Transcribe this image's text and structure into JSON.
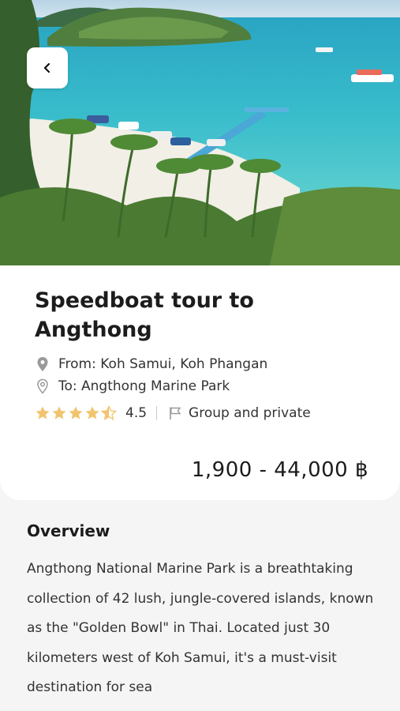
{
  "hero": {
    "image_description_icon": "island-beach-photo",
    "back_icon": "chevron-left-icon"
  },
  "tour": {
    "title": "Speedboat tour to Angthong",
    "from": "From: Koh Samui, Koh Phangan",
    "to": "To: Angthong Marine Park",
    "rating": "4.5",
    "rating_stars": 4.5,
    "group_type": "Group and private",
    "price": "1,900 - 44,000 ฿"
  },
  "overview": {
    "heading": "Overview",
    "text": "Angthong National Marine Park is a breathtaking collection of 42 lush, jungle-covered islands, known as the \"Golden Bowl\" in Thai. Located just 30 kilometers west of Koh Samui, it's a must-visit destination for sea"
  },
  "colors": {
    "star": "#f2c46d",
    "icon_gray": "#9a9a9a",
    "card_bg": "#ffffff",
    "page_bg": "#f5f5f5"
  }
}
